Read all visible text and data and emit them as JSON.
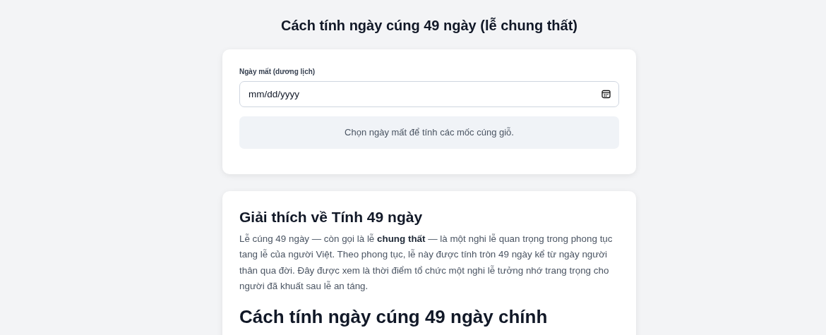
{
  "page_title": "Cách tính ngày cúng 49 ngày (lễ chung thất)",
  "calculator": {
    "date_field": {
      "label": "Ngày mất (dương lịch)",
      "placeholder": "mm/dd/yyyy"
    },
    "message": "Chọn ngày mất để tính các mốc cúng giỗ."
  },
  "explanation": {
    "heading": "Giải thích về Tính 49 ngày",
    "paragraph": "Lễ cúng 49 ngày — còn gọi là lễ **chung thất** — là một nghi lễ quan trọng trong phong tục tang lễ của người Việt. Theo phong tục, lễ này được tính tròn 49 ngày kể từ ngày người thân qua đời. Đây được xem là thời điểm tổ chức một nghi lễ tưởng nhớ trang trọng cho người đã khuất sau lễ an táng.",
    "next_heading": "Cách tính ngày cúng 49 ngày chính"
  }
}
